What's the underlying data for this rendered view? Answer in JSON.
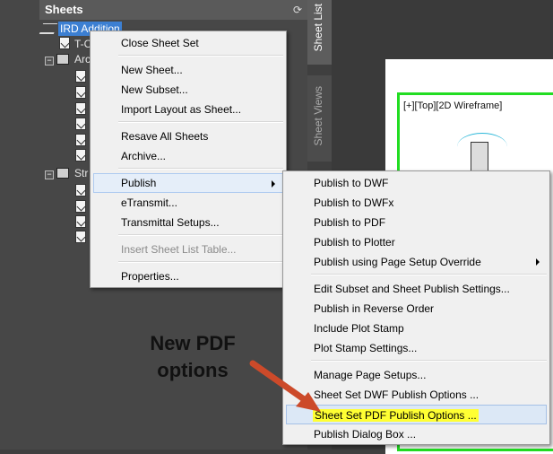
{
  "panel": {
    "title": "Sheets",
    "tree": [
      {
        "label": "IRD Addition",
        "kind": "set",
        "selected": true
      },
      {
        "label": "T-C",
        "kind": "sheet"
      },
      {
        "label": "Arc",
        "kind": "subset"
      },
      {
        "label": "Str",
        "kind": "subset"
      }
    ]
  },
  "tabs": {
    "sheet_list": "Sheet List",
    "sheet_views": "Sheet Views"
  },
  "viewport": {
    "label": "[+][Top][2D Wireframe]"
  },
  "context_menu": {
    "items": [
      "Close Sheet Set",
      "New Sheet...",
      "New Subset...",
      "Import Layout as Sheet...",
      "Resave All Sheets",
      "Archive...",
      "Publish",
      "eTransmit...",
      "Transmittal Setups...",
      "Insert Sheet List Table...",
      "Properties..."
    ]
  },
  "publish_submenu": {
    "items": [
      "Publish to DWF",
      "Publish to DWFx",
      "Publish to PDF",
      "Publish to Plotter",
      "Publish using Page Setup Override",
      "Edit Subset and Sheet Publish Settings...",
      "Publish in Reverse Order",
      "Include Plot Stamp",
      "Plot Stamp Settings...",
      "Manage Page Setups...",
      "Sheet Set DWF Publish Options ...",
      "Sheet Set PDF Publish Options ...",
      "Publish Dialog Box ..."
    ]
  },
  "annotation": {
    "line1": "New PDF",
    "line2": "options"
  },
  "colors": {
    "selection": "#3c7fd2",
    "highlight": "#ffff33",
    "viewport_border": "#22dd22",
    "arrow": "#cc4a2a"
  }
}
